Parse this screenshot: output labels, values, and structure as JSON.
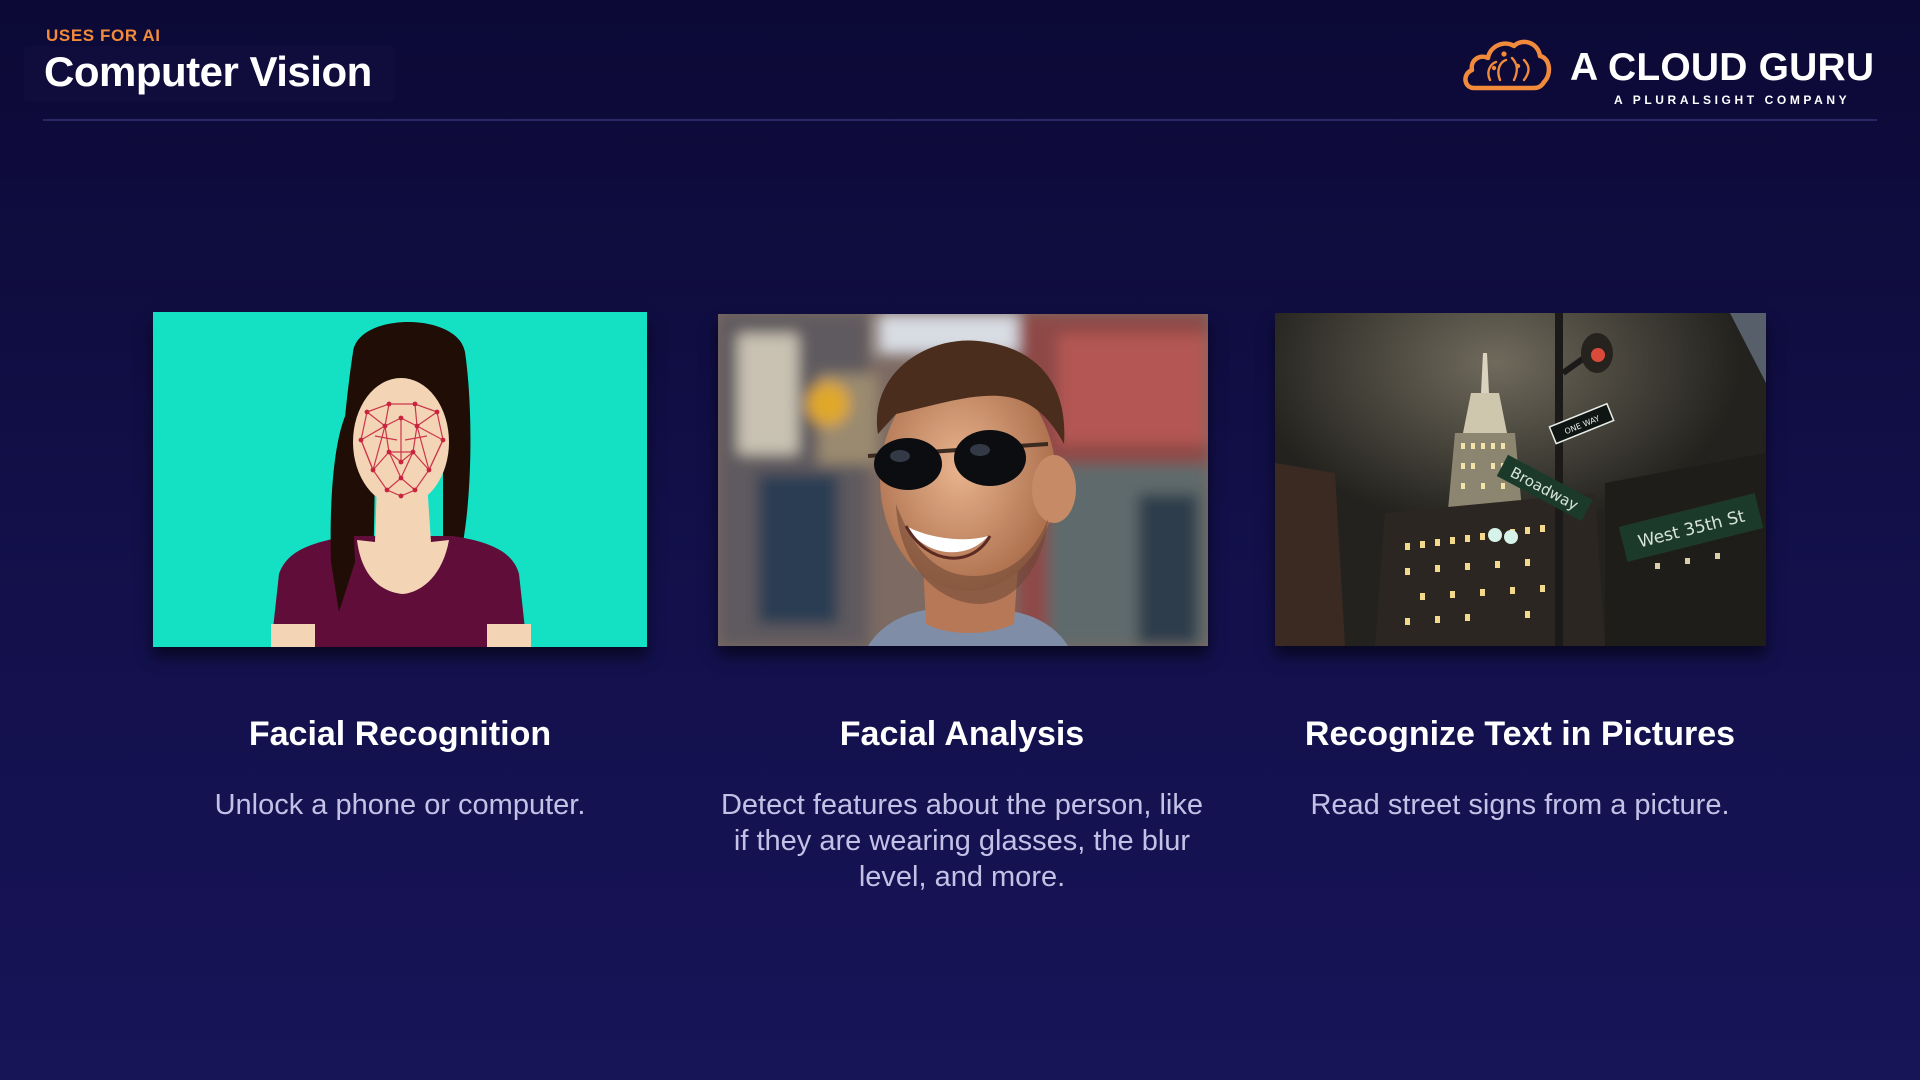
{
  "header": {
    "eyebrow": "USES FOR AI",
    "title": "Computer Vision"
  },
  "brand": {
    "name": "A CLOUD GURU",
    "tagline": "A PLURALSIGHT COMPANY",
    "logo_icon": "cloud-logo-icon",
    "accent_color": "#f28a3c"
  },
  "cards": [
    {
      "image": "woman-face-mesh-illustration",
      "title": "Facial Recognition",
      "description": "Unlock a phone or computer."
    },
    {
      "image": "smiling-man-sunglasses-photo",
      "title": "Facial Analysis",
      "description": "Detect features about the person, like if they are wearing glasses, the blur level, and more."
    },
    {
      "image": "night-street-signs-photo",
      "title": "Recognize Text in Pictures",
      "description": "Read street signs from a picture.",
      "image_text": {
        "sign_1": "Broadway",
        "sign_2": "West 35th St",
        "sign_3": "ONE WAY"
      }
    }
  ],
  "colors": {
    "background": "#120f48",
    "accent": "#f28a3c",
    "description_text": "#c3c1e6"
  }
}
